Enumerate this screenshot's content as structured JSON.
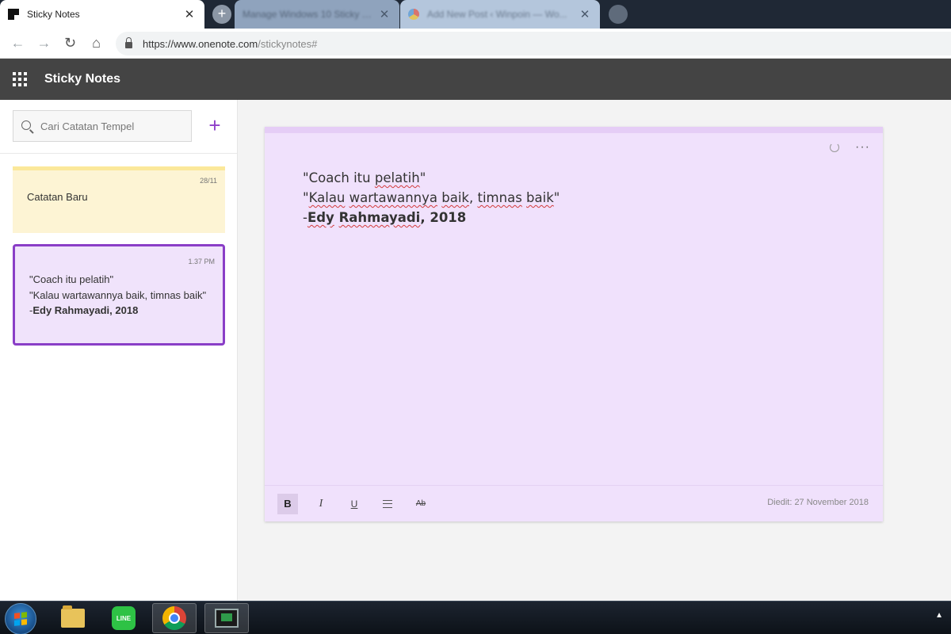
{
  "browser": {
    "tabs": [
      {
        "title": "Sticky Notes",
        "active": true
      },
      {
        "title": "Manage Windows 10 Sticky No..."
      },
      {
        "title": "Add New Post ‹ Winpoin — Wo..."
      }
    ],
    "new_tab_symbol": "+",
    "close_symbol": "✕",
    "nav": {
      "back": "←",
      "forward": "→",
      "reload": "↻",
      "home": "⌂"
    },
    "url_host": "https://www.onenote.com",
    "url_path": "/stickynotes#"
  },
  "app": {
    "title": "Sticky Notes"
  },
  "sidebar": {
    "search_placeholder": "Cari Catatan Tempel",
    "add_symbol": "+",
    "notes": [
      {
        "time": "28/11",
        "text": "Catatan Baru",
        "color": "#fdf4d4"
      },
      {
        "time": "1.37 PM",
        "lines": [
          "\"Coach itu pelatih\"",
          "\"Kalau wartawannya baik, timnas baik\""
        ],
        "bold_prefix": "-",
        "bold_line": "Edy Rahmayadi, 2018",
        "color": "#f0e3fb"
      }
    ]
  },
  "editor": {
    "line1": {
      "q1": "\"Coach itu ",
      "sq1": "pelatih",
      "q2": "\""
    },
    "line2": {
      "q1": "\"",
      "sq1": "Kalau",
      "q2": " ",
      "sq2": "wartawannya",
      "q3": " ",
      "sq3": "baik",
      "q4": ", ",
      "sq4": "timnas",
      "q5": " ",
      "sq5": "baik",
      "q6": "\""
    },
    "line3": {
      "prefix": "-",
      "sq1": "Edy",
      "mid": " ",
      "sq2": "Rahmayadi",
      "tail": ", 2018"
    },
    "more_symbol": "···",
    "format": {
      "bold": "B",
      "italic": "I",
      "underline": "U",
      "strike": "Ab"
    },
    "edited": "Diedit: 27 November 2018",
    "accent_color": "#8a3ec7"
  },
  "taskbar": {
    "line_label": "LINE",
    "tray_symbol": "▲"
  }
}
